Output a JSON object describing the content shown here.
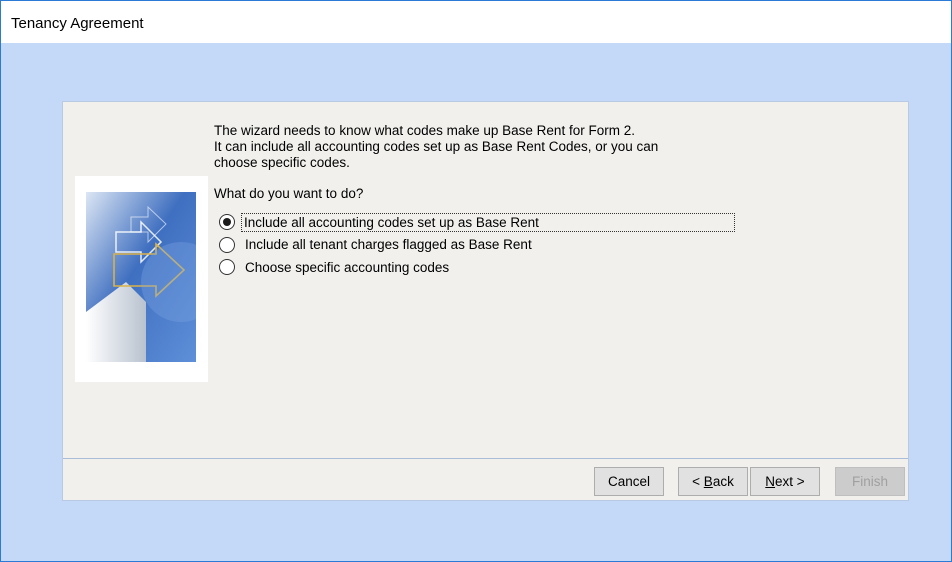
{
  "window": {
    "title": "Tenancy Agreement"
  },
  "wizard": {
    "intro_lines": [
      "The wizard needs to know what codes make up Base Rent for Form 2.",
      "It can include all accounting codes set up as Base Rent Codes, or you can",
      "choose specific codes."
    ],
    "question": "What do you want to do?",
    "options": [
      {
        "label": "Include all accounting codes set up as Base Rent",
        "selected": true
      },
      {
        "label": "Include all tenant charges flagged as Base Rent",
        "selected": false
      },
      {
        "label": "Choose specific accounting codes",
        "selected": false
      }
    ]
  },
  "buttons": {
    "cancel": "Cancel",
    "back_prefix": "< ",
    "back_hotkey": "B",
    "back_rest": "ack",
    "next_hotkey": "N",
    "next_rest": "ext >",
    "finish": "Finish"
  },
  "colors": {
    "workspace": "#c4d9f7",
    "dialog": "#f1f0ed",
    "button": "#e1e1e1"
  }
}
